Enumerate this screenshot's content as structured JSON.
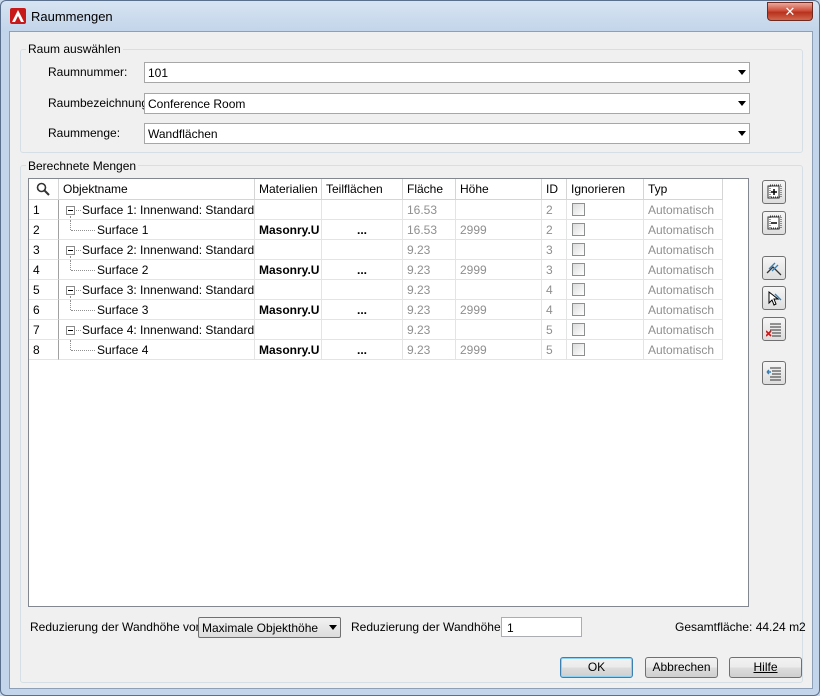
{
  "window": {
    "title": "Raummengen",
    "close_glyph": "✕"
  },
  "room_group": {
    "legend": "Raum auswählen",
    "number_label": "Raumnummer:",
    "number_value": "101",
    "name_label": "Raumbezeichnung:",
    "name_value": "Conference Room",
    "quantity_label": "Raummenge:",
    "quantity_value": "Wandflächen"
  },
  "results_group": {
    "legend": "Berechnete Mengen",
    "columns": [
      "Objektname",
      "Materialien",
      "Teilflächen",
      "Fläche",
      "Höhe",
      "ID",
      "Ignorieren",
      "Typ"
    ],
    "rows": [
      {
        "num": "1",
        "name": "Surface 1: Innenwand: Standard",
        "material": "",
        "parts": "",
        "area": "16.53",
        "height": "",
        "id": "2",
        "type": "Automatisch",
        "parent": true
      },
      {
        "num": "2",
        "name": "Surface 1",
        "material": "Masonry.U",
        "parts": "...",
        "area": "16.53",
        "height": "2999",
        "id": "2",
        "type": "Automatisch",
        "parent": false
      },
      {
        "num": "3",
        "name": "Surface 2: Innenwand: Standard",
        "material": "",
        "parts": "",
        "area": "9.23",
        "height": "",
        "id": "3",
        "type": "Automatisch",
        "parent": true
      },
      {
        "num": "4",
        "name": "Surface 2",
        "material": "Masonry.U",
        "parts": "...",
        "area": "9.23",
        "height": "2999",
        "id": "3",
        "type": "Automatisch",
        "parent": false
      },
      {
        "num": "5",
        "name": "Surface 3: Innenwand: Standard",
        "material": "",
        "parts": "",
        "area": "9.23",
        "height": "",
        "id": "4",
        "type": "Automatisch",
        "parent": true
      },
      {
        "num": "6",
        "name": "Surface 3",
        "material": "Masonry.U",
        "parts": "...",
        "area": "9.23",
        "height": "2999",
        "id": "4",
        "type": "Automatisch",
        "parent": false
      },
      {
        "num": "7",
        "name": "Surface 4: Innenwand: Standard",
        "material": "",
        "parts": "",
        "area": "9.23",
        "height": "",
        "id": "5",
        "type": "Automatisch",
        "parent": true
      },
      {
        "num": "8",
        "name": "Surface 4",
        "material": "Masonry.U",
        "parts": "...",
        "area": "9.23",
        "height": "2999",
        "id": "5",
        "type": "Automatisch",
        "parent": false
      }
    ]
  },
  "footer": {
    "reduce_from_label": "Reduzierung der Wandhöhe von",
    "reduce_from_value": "Maximale Objekthöhe",
    "reduce_label": "Reduzierung der Wandhöhe",
    "reduce_value": "1",
    "total": "Gesamtfläche: 44.24 m2"
  },
  "buttons": {
    "ok": "OK",
    "cancel": "Abbrechen",
    "help": "Hilfe"
  },
  "icons": {
    "search": "search-icon",
    "side": [
      "expand-all-icon",
      "collapse-all-icon",
      "edit-surface-icon",
      "select-object-icon",
      "delete-row-icon",
      "import-row-icon"
    ]
  },
  "colors": {
    "accent": "#3c7fb1",
    "muted_text": "#8f8f8f",
    "close_button": "#cf4f3a"
  }
}
